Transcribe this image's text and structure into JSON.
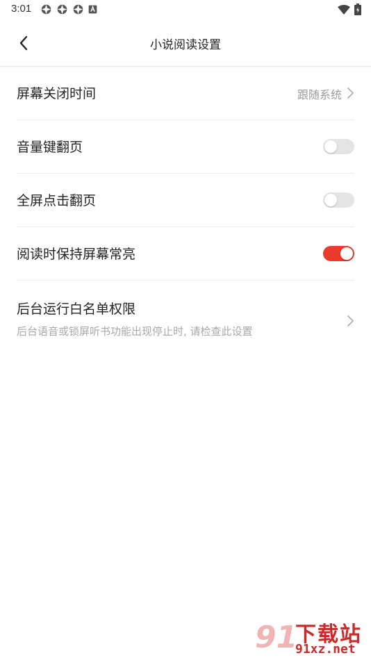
{
  "status_bar": {
    "time": "3:01",
    "left_icons": [
      "app-notification-icon",
      "app-notification-icon",
      "app-notification-icon",
      "text-a-icon"
    ],
    "right_icons": [
      "wifi-icon",
      "battery-icon"
    ]
  },
  "nav": {
    "title": "小说阅读设置",
    "back_icon": "chevron-left-icon"
  },
  "settings": {
    "screen_off": {
      "label": "屏幕关闭时间",
      "value": "跟随系统"
    },
    "volume_key": {
      "label": "音量键翻页",
      "enabled": false
    },
    "full_tap": {
      "label": "全屏点击翻页",
      "enabled": false
    },
    "keep_on": {
      "label": "阅读时保持屏幕常亮",
      "enabled": true
    },
    "whitelist": {
      "label": "后台运行白名单权限",
      "subtitle": "后台语音或锁屏听书功能出现停止时, 请检查此设置"
    }
  },
  "watermark": {
    "logo": "91",
    "title": "下载站",
    "url": "91xz.net"
  },
  "colors": {
    "accent": "#ea3a2c",
    "toggle_off": "#e4e4e4",
    "secondary_text": "#9a9a9a"
  }
}
